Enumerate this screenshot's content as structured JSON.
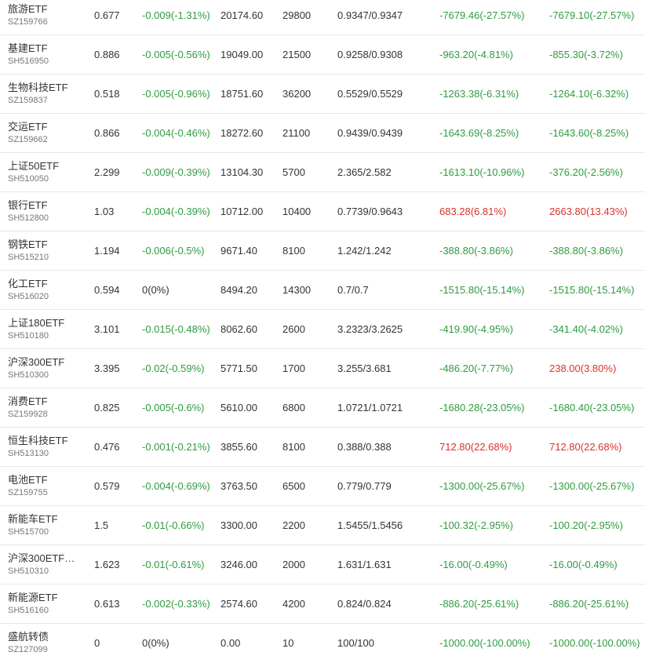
{
  "colors": {
    "up": "#d9322b",
    "down": "#2e9c3f",
    "flat": "#333333"
  },
  "holdings": [
    {
      "name": "旅游ETF",
      "code": "SZ159766",
      "price": "0.677",
      "change": "-0.009(-1.31%)",
      "change_dir": "down",
      "market_value": "20174.60",
      "quantity": "29800",
      "cost": "0.9347/0.9347",
      "pl": "-7679.46(-27.57%)",
      "pl_dir": "down",
      "pl2": "-7679.10(-27.57%)",
      "pl2_dir": "down"
    },
    {
      "name": "基建ETF",
      "code": "SH516950",
      "price": "0.886",
      "change": "-0.005(-0.56%)",
      "change_dir": "down",
      "market_value": "19049.00",
      "quantity": "21500",
      "cost": "0.9258/0.9308",
      "pl": "-963.20(-4.81%)",
      "pl_dir": "down",
      "pl2": "-855.30(-3.72%)",
      "pl2_dir": "down"
    },
    {
      "name": "生物科技ETF",
      "code": "SZ159837",
      "price": "0.518",
      "change": "-0.005(-0.96%)",
      "change_dir": "down",
      "market_value": "18751.60",
      "quantity": "36200",
      "cost": "0.5529/0.5529",
      "pl": "-1263.38(-6.31%)",
      "pl_dir": "down",
      "pl2": "-1264.10(-6.32%)",
      "pl2_dir": "down"
    },
    {
      "name": "交运ETF",
      "code": "SZ159662",
      "price": "0.866",
      "change": "-0.004(-0.46%)",
      "change_dir": "down",
      "market_value": "18272.60",
      "quantity": "21100",
      "cost": "0.9439/0.9439",
      "pl": "-1643.69(-8.25%)",
      "pl_dir": "down",
      "pl2": "-1643.60(-8.25%)",
      "pl2_dir": "down"
    },
    {
      "name": "上证50ETF",
      "code": "SH510050",
      "price": "2.299",
      "change": "-0.009(-0.39%)",
      "change_dir": "down",
      "market_value": "13104.30",
      "quantity": "5700",
      "cost": "2.365/2.582",
      "pl": "-1613.10(-10.96%)",
      "pl_dir": "down",
      "pl2": "-376.20(-2.56%)",
      "pl2_dir": "down"
    },
    {
      "name": "银行ETF",
      "code": "SH512800",
      "price": "1.03",
      "change": "-0.004(-0.39%)",
      "change_dir": "down",
      "market_value": "10712.00",
      "quantity": "10400",
      "cost": "0.7739/0.9643",
      "pl": "683.28(6.81%)",
      "pl_dir": "up",
      "pl2": "2663.80(13.43%)",
      "pl2_dir": "up"
    },
    {
      "name": "钢铁ETF",
      "code": "SH515210",
      "price": "1.194",
      "change": "-0.006(-0.5%)",
      "change_dir": "down",
      "market_value": "9671.40",
      "quantity": "8100",
      "cost": "1.242/1.242",
      "pl": "-388.80(-3.86%)",
      "pl_dir": "down",
      "pl2": "-388.80(-3.86%)",
      "pl2_dir": "down"
    },
    {
      "name": "化工ETF",
      "code": "SH516020",
      "price": "0.594",
      "change": "0(0%)",
      "change_dir": "flat",
      "market_value": "8494.20",
      "quantity": "14300",
      "cost": "0.7/0.7",
      "pl": "-1515.80(-15.14%)",
      "pl_dir": "down",
      "pl2": "-1515.80(-15.14%)",
      "pl2_dir": "down"
    },
    {
      "name": "上证180ETF",
      "code": "SH510180",
      "price": "3.101",
      "change": "-0.015(-0.48%)",
      "change_dir": "down",
      "market_value": "8062.60",
      "quantity": "2600",
      "cost": "3.2323/3.2625",
      "pl": "-419.90(-4.95%)",
      "pl_dir": "down",
      "pl2": "-341.40(-4.02%)",
      "pl2_dir": "down"
    },
    {
      "name": "沪深300ETF",
      "code": "SH510300",
      "price": "3.395",
      "change": "-0.02(-0.59%)",
      "change_dir": "down",
      "market_value": "5771.50",
      "quantity": "1700",
      "cost": "3.255/3.681",
      "pl": "-486.20(-7.77%)",
      "pl_dir": "down",
      "pl2": "238.00(3.80%)",
      "pl2_dir": "up"
    },
    {
      "name": "消费ETF",
      "code": "SZ159928",
      "price": "0.825",
      "change": "-0.005(-0.6%)",
      "change_dir": "down",
      "market_value": "5610.00",
      "quantity": "6800",
      "cost": "1.0721/1.0721",
      "pl": "-1680.28(-23.05%)",
      "pl_dir": "down",
      "pl2": "-1680.40(-23.05%)",
      "pl2_dir": "down"
    },
    {
      "name": "恒生科技ETF",
      "code": "SH513130",
      "price": "0.476",
      "change": "-0.001(-0.21%)",
      "change_dir": "down",
      "market_value": "3855.60",
      "quantity": "8100",
      "cost": "0.388/0.388",
      "pl": "712.80(22.68%)",
      "pl_dir": "up",
      "pl2": "712.80(22.68%)",
      "pl2_dir": "up"
    },
    {
      "name": "电池ETF",
      "code": "SZ159755",
      "price": "0.579",
      "change": "-0.004(-0.69%)",
      "change_dir": "down",
      "market_value": "3763.50",
      "quantity": "6500",
      "cost": "0.779/0.779",
      "pl": "-1300.00(-25.67%)",
      "pl_dir": "down",
      "pl2": "-1300.00(-25.67%)",
      "pl2_dir": "down"
    },
    {
      "name": "新能车ETF",
      "code": "SH515700",
      "price": "1.5",
      "change": "-0.01(-0.66%)",
      "change_dir": "down",
      "market_value": "3300.00",
      "quantity": "2200",
      "cost": "1.5455/1.5456",
      "pl": "-100.32(-2.95%)",
      "pl_dir": "down",
      "pl2": "-100.20(-2.95%)",
      "pl2_dir": "down"
    },
    {
      "name": "沪深300ETF…",
      "code": "SH510310",
      "price": "1.623",
      "change": "-0.01(-0.61%)",
      "change_dir": "down",
      "market_value": "3246.00",
      "quantity": "2000",
      "cost": "1.631/1.631",
      "pl": "-16.00(-0.49%)",
      "pl_dir": "down",
      "pl2": "-16.00(-0.49%)",
      "pl2_dir": "down"
    },
    {
      "name": "新能源ETF",
      "code": "SH516160",
      "price": "0.613",
      "change": "-0.002(-0.33%)",
      "change_dir": "down",
      "market_value": "2574.60",
      "quantity": "4200",
      "cost": "0.824/0.824",
      "pl": "-886.20(-25.61%)",
      "pl_dir": "down",
      "pl2": "-886.20(-25.61%)",
      "pl2_dir": "down"
    },
    {
      "name": "盛航转债",
      "code": "SZ127099",
      "price": "0",
      "change": "0(0%)",
      "change_dir": "flat",
      "market_value": "0.00",
      "quantity": "10",
      "cost": "100/100",
      "pl": "-1000.00(-100.00%)",
      "pl_dir": "down",
      "pl2": "-1000.00(-100.00%)",
      "pl2_dir": "down"
    }
  ]
}
